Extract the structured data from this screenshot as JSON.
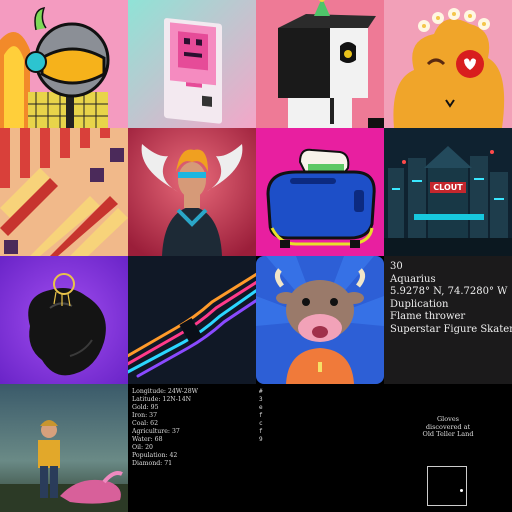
{
  "gallery": {
    "tiles": [
      {
        "id": "astronaut-avatar",
        "alt_icon": "astronaut-helmet-icon"
      },
      {
        "id": "pink-robot-card",
        "alt_icon": "robot-icon"
      },
      {
        "id": "cube-head-character",
        "alt_icon": "party-hat-icon"
      },
      {
        "id": "flower-crown-blob",
        "alt_icon": "flower-crown-icon"
      },
      {
        "id": "pixel-pattern",
        "alt_icon": "pattern-icon"
      },
      {
        "id": "winged-hero",
        "alt_icon": "angel-wings-icon"
      },
      {
        "id": "blue-toaster",
        "alt_icon": "toaster-icon"
      },
      {
        "id": "clout-neon-city",
        "alt_icon": "city-icon",
        "sign_text": "CLOUT"
      },
      {
        "id": "black-blob-sculpture",
        "alt_icon": "sculpture-icon"
      },
      {
        "id": "neon-tube-abstract",
        "alt_icon": "neon-lines-icon"
      },
      {
        "id": "cow-character",
        "alt_icon": "cow-icon"
      },
      {
        "id": "zodiac-traits-card",
        "lines": [
          "30",
          "Aquarius",
          "5.9278° N, 74.7280° W",
          "Duplication",
          "Flame thrower",
          "Superstar Figure Skater"
        ]
      },
      {
        "id": "girl-with-creature",
        "alt_icon": "landscape-icon"
      },
      {
        "id": "land-stats-card",
        "lines": [
          "Longitude: 24W-28W",
          "Latitude: 12N-14N",
          "Gold: 95",
          "Iron: 37",
          "Coal: 62",
          "Agriculture: 37",
          "Water: 68",
          "Oil: 20",
          "Population: 42",
          "Diamond: 71"
        ]
      },
      {
        "id": "hex-code-card",
        "lines": [
          "#",
          "3",
          "e",
          "f",
          "c",
          "f",
          "9"
        ]
      },
      {
        "id": "loot-card",
        "caption": [
          "Gloves",
          "discovered at",
          "Old Teller Land"
        ]
      }
    ]
  },
  "colors": {
    "pink_bg": "#f08fb0",
    "teal_bg": "#7fd6c8",
    "toaster_bg": "#e81fa0",
    "purple_bg": "#8a3be0",
    "cow_bg": "#2d5fd6",
    "card_bg": "#1b1a1b"
  }
}
